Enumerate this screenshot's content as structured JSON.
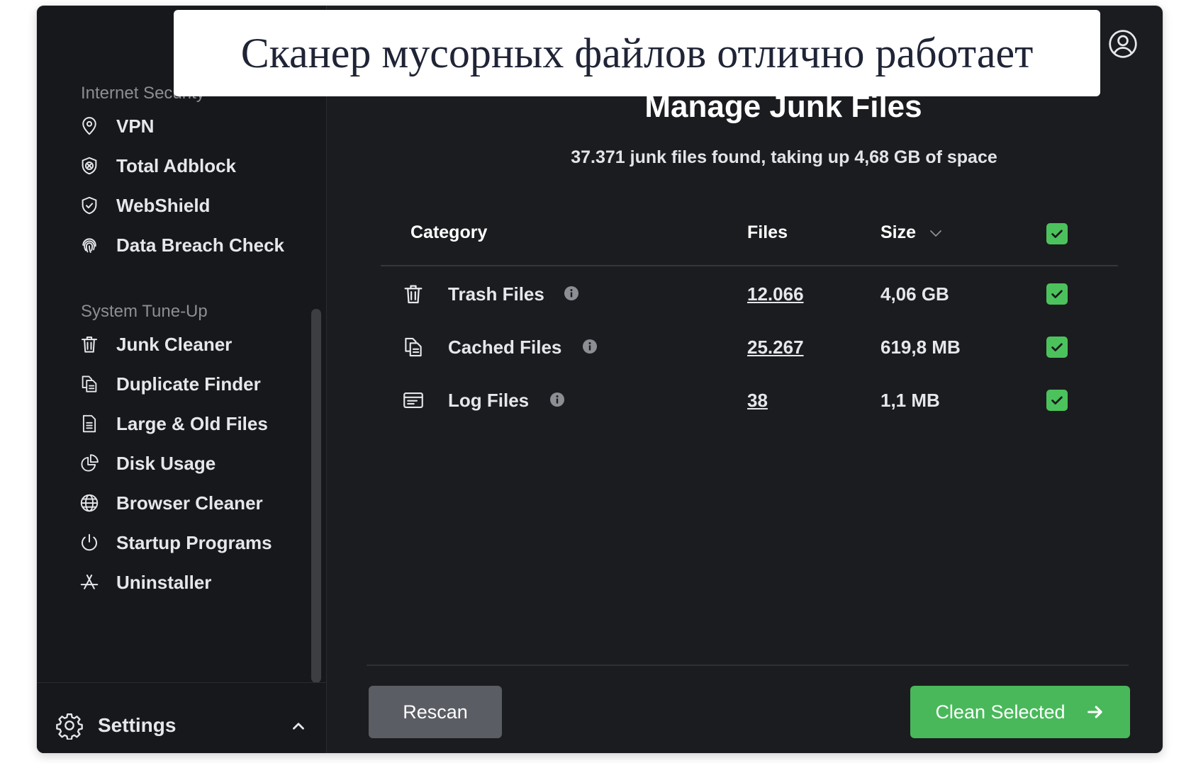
{
  "caption": "Сканер мусорных файлов отлично работает",
  "sidebar": {
    "sections": [
      {
        "title": "Internet Security",
        "items": [
          {
            "label": "VPN",
            "icon": "location-pin-icon"
          },
          {
            "label": "Total Adblock",
            "icon": "shield-x-icon"
          },
          {
            "label": "WebShield",
            "icon": "shield-check-icon"
          },
          {
            "label": "Data Breach Check",
            "icon": "fingerprint-icon"
          }
        ]
      },
      {
        "title": "System Tune-Up",
        "items": [
          {
            "label": "Junk Cleaner",
            "icon": "trash-icon"
          },
          {
            "label": "Duplicate Finder",
            "icon": "duplicate-files-icon"
          },
          {
            "label": "Large & Old Files",
            "icon": "document-icon"
          },
          {
            "label": "Disk Usage",
            "icon": "pie-chart-icon"
          },
          {
            "label": "Browser Cleaner",
            "icon": "globe-icon"
          },
          {
            "label": "Startup Programs",
            "icon": "power-icon"
          },
          {
            "label": "Uninstaller",
            "icon": "app-store-icon"
          }
        ]
      }
    ],
    "settings_label": "Settings"
  },
  "main": {
    "title": "Manage Junk Files",
    "subtitle": "37.371 junk files found, taking up 4,68 GB of space",
    "table": {
      "headers": {
        "category": "Category",
        "files": "Files",
        "size": "Size"
      },
      "rows": [
        {
          "category": "Trash Files",
          "files": "12.066",
          "size": "4,06 GB",
          "checked": true,
          "icon": "trash-icon"
        },
        {
          "category": "Cached Files",
          "files": "25.267",
          "size": "619,8 MB",
          "checked": true,
          "icon": "cached-files-icon"
        },
        {
          "category": "Log Files",
          "files": "38",
          "size": "1,1 MB",
          "checked": true,
          "icon": "log-files-icon"
        }
      ]
    },
    "buttons": {
      "rescan": "Rescan",
      "clean": "Clean Selected"
    }
  },
  "colors": {
    "background": "#1b1c1f",
    "sidebar": "#17181b",
    "accent_green": "#4cc25c",
    "rescan_button": "#5a5d63"
  }
}
